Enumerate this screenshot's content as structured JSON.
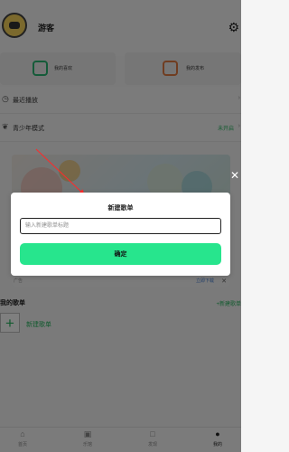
{
  "profile": {
    "username": "游客"
  },
  "quick_actions": {
    "favorites": "我的喜欢",
    "publications": "我的发布"
  },
  "menu": {
    "recent_label": "最近播放",
    "youth_label": "青少年模式",
    "youth_status": "未开启"
  },
  "banner": {
    "tag": "广告",
    "download_label": "立即下载"
  },
  "playlists": {
    "section_title": "我的歌单",
    "new_button_label": "+新建歌单",
    "new_item_label": "新建歌单"
  },
  "tabbar": {
    "items": [
      {
        "label": "首页"
      },
      {
        "label": "乐馆"
      },
      {
        "label": "发现"
      },
      {
        "label": "我的"
      }
    ]
  },
  "dialog": {
    "title": "新建歌单",
    "input_placeholder": "输入新建歌单标题",
    "input_value": "",
    "confirm_label": "确定"
  },
  "icons": {
    "avatar": "avatar-icon",
    "settings": "gear-icon",
    "favorites": "heart-box-icon",
    "publications": "heart-box-icon",
    "recent": "clock-icon",
    "youth": "sprout-icon",
    "close": "close-icon",
    "add": "plus-icon"
  },
  "colors": {
    "accent": "#27e58d",
    "link_green": "#26b55e",
    "download_blue": "#4a83d4",
    "overlay": "rgba(0,0,0,0.5)"
  }
}
